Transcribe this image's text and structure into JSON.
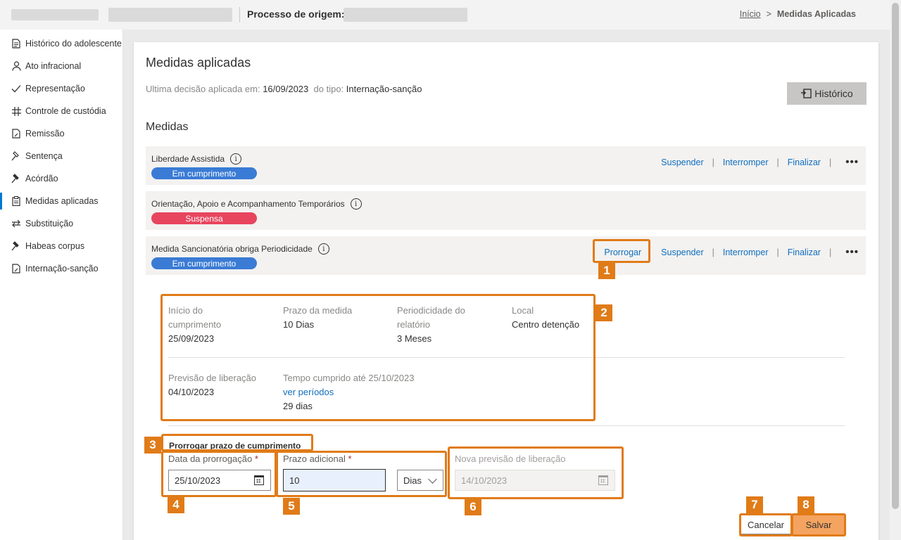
{
  "topbar": {
    "origin_label": "Processo de origem:",
    "breadcrumb": {
      "home": "Início",
      "separator": ">",
      "current": "Medidas Aplicadas"
    }
  },
  "sidebar": {
    "items": [
      {
        "label": "Histórico do adolescente",
        "icon": "document-icon"
      },
      {
        "label": "Ato infracional",
        "icon": "person-icon"
      },
      {
        "label": "Representação",
        "icon": "check-icon"
      },
      {
        "label": "Controle de custódia",
        "icon": "grid-icon"
      },
      {
        "label": "Remissão",
        "icon": "document-edit-icon"
      },
      {
        "label": "Sentença",
        "icon": "gavel-icon"
      },
      {
        "label": "Acórdão",
        "icon": "gavel-icon"
      },
      {
        "label": "Medidas aplicadas",
        "icon": "clipboard-icon",
        "active": true
      },
      {
        "label": "Substituição",
        "icon": "swap-icon"
      },
      {
        "label": "Habeas corpus",
        "icon": "gavel-icon"
      },
      {
        "label": "Internação-sanção",
        "icon": "document-edit-icon"
      }
    ]
  },
  "main": {
    "title": "Medidas aplicadas",
    "last_decision_label": "Ultima decisão aplicada em:",
    "last_decision_date": "16/09/2023",
    "type_label": "do tipo:",
    "type_value": "Internação-sanção",
    "history_button": "Histórico",
    "section_title": "Medidas",
    "measures": [
      {
        "name": "Liberdade Assistida",
        "status": "Em cumprimento",
        "status_color": "#3a7bd5",
        "actions": [
          "Suspender",
          "Interromper",
          "Finalizar"
        ]
      },
      {
        "name": "Orientação, Apoio e Acompanhamento Temporários",
        "status": "Suspensa",
        "status_color": "#e8455e",
        "actions": []
      },
      {
        "name": "Medida Sancionatória obriga Periodicidade",
        "status": "Em cumprimento",
        "status_color": "#3a7bd5",
        "actions": [
          "Prorrogar",
          "Suspender",
          "Interromper",
          "Finalizar"
        ]
      }
    ],
    "more_label": "•••",
    "info_glyph": "i"
  },
  "details": {
    "inicio_label_1": "Início do",
    "inicio_label_2": "cumprimento",
    "inicio_value": "25/09/2023",
    "prazo_label": "Prazo da medida",
    "prazo_value": "10 Dias",
    "period_label_1": "Periodicidade do",
    "period_label_2": "relatório",
    "period_value": "3 Meses",
    "local_label": "Local",
    "local_value": "Centro detenção",
    "previsao_label": "Previsão de liberação",
    "previsao_value": "04/10/2023",
    "tempo_label": "Tempo cumprido até 25/10/2023",
    "tempo_link": "ver períodos",
    "tempo_value": "29 dias"
  },
  "form": {
    "title": "Prorrogar prazo de cumprimento",
    "data_label": "Data da prorrogação",
    "data_value": "25/10/2023",
    "prazo_label": "Prazo adicional",
    "prazo_value": "10",
    "unit_value": "Dias",
    "nova_label": "Nova previsão de liberação",
    "nova_value": "14/10/2023",
    "required_mark": "*",
    "cancel": "Cancelar",
    "save": "Salvar"
  },
  "annotations": [
    "1",
    "2",
    "3",
    "4",
    "5",
    "6",
    "7",
    "8"
  ],
  "colors": {
    "accent": "#0078d4",
    "link": "#106ebe",
    "annotation": "#e07b18",
    "save_button": "#f4a460"
  }
}
